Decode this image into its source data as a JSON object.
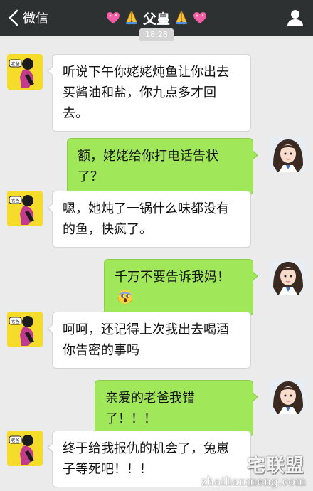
{
  "nav": {
    "back_label": "微信",
    "title": "父皇",
    "title_emoji": [
      "sparkling-heart",
      "folded-hands",
      "folded-hands",
      "sparkling-heart"
    ],
    "profile_icon": "person-icon",
    "background": "#2e3132"
  },
  "timestamp": "18:28",
  "messages": [
    {
      "sender": "dad",
      "text": "听说下午你姥姥炖鱼让你出去买酱油和盐，你九点多才回去。"
    },
    {
      "sender": "me",
      "text": "额，姥姥给你打电话告状了？"
    },
    {
      "sender": "dad",
      "text": "嗯，她炖了一锅什么味都没有的鱼，快疯了。"
    },
    {
      "sender": "me",
      "text": "千万不要告诉我妈！",
      "emoji": "face-screaming-in-fear"
    },
    {
      "sender": "dad",
      "text": "呵呵，还记得上次我出去喝酒你告密的事吗"
    },
    {
      "sender": "me",
      "text": "亲爱的老爸我错了！！！"
    },
    {
      "sender": "dad",
      "text": "终于给我报仇的机会了，兔崽子等死吧！！！"
    }
  ],
  "avatars": {
    "dad_badge": "老爸",
    "dad_icon": "cartoon-dad-avatar",
    "me_icon": "girl-photo-avatar"
  },
  "colors": {
    "chat_background": "#ebebeb",
    "incoming_bubble": "#ffffff",
    "outgoing_bubble": "#a0e75a",
    "avatar_yellow": "#f6dc2a"
  },
  "watermark": {
    "cn": "宅联盟",
    "url": "zhailianmeng.com"
  }
}
